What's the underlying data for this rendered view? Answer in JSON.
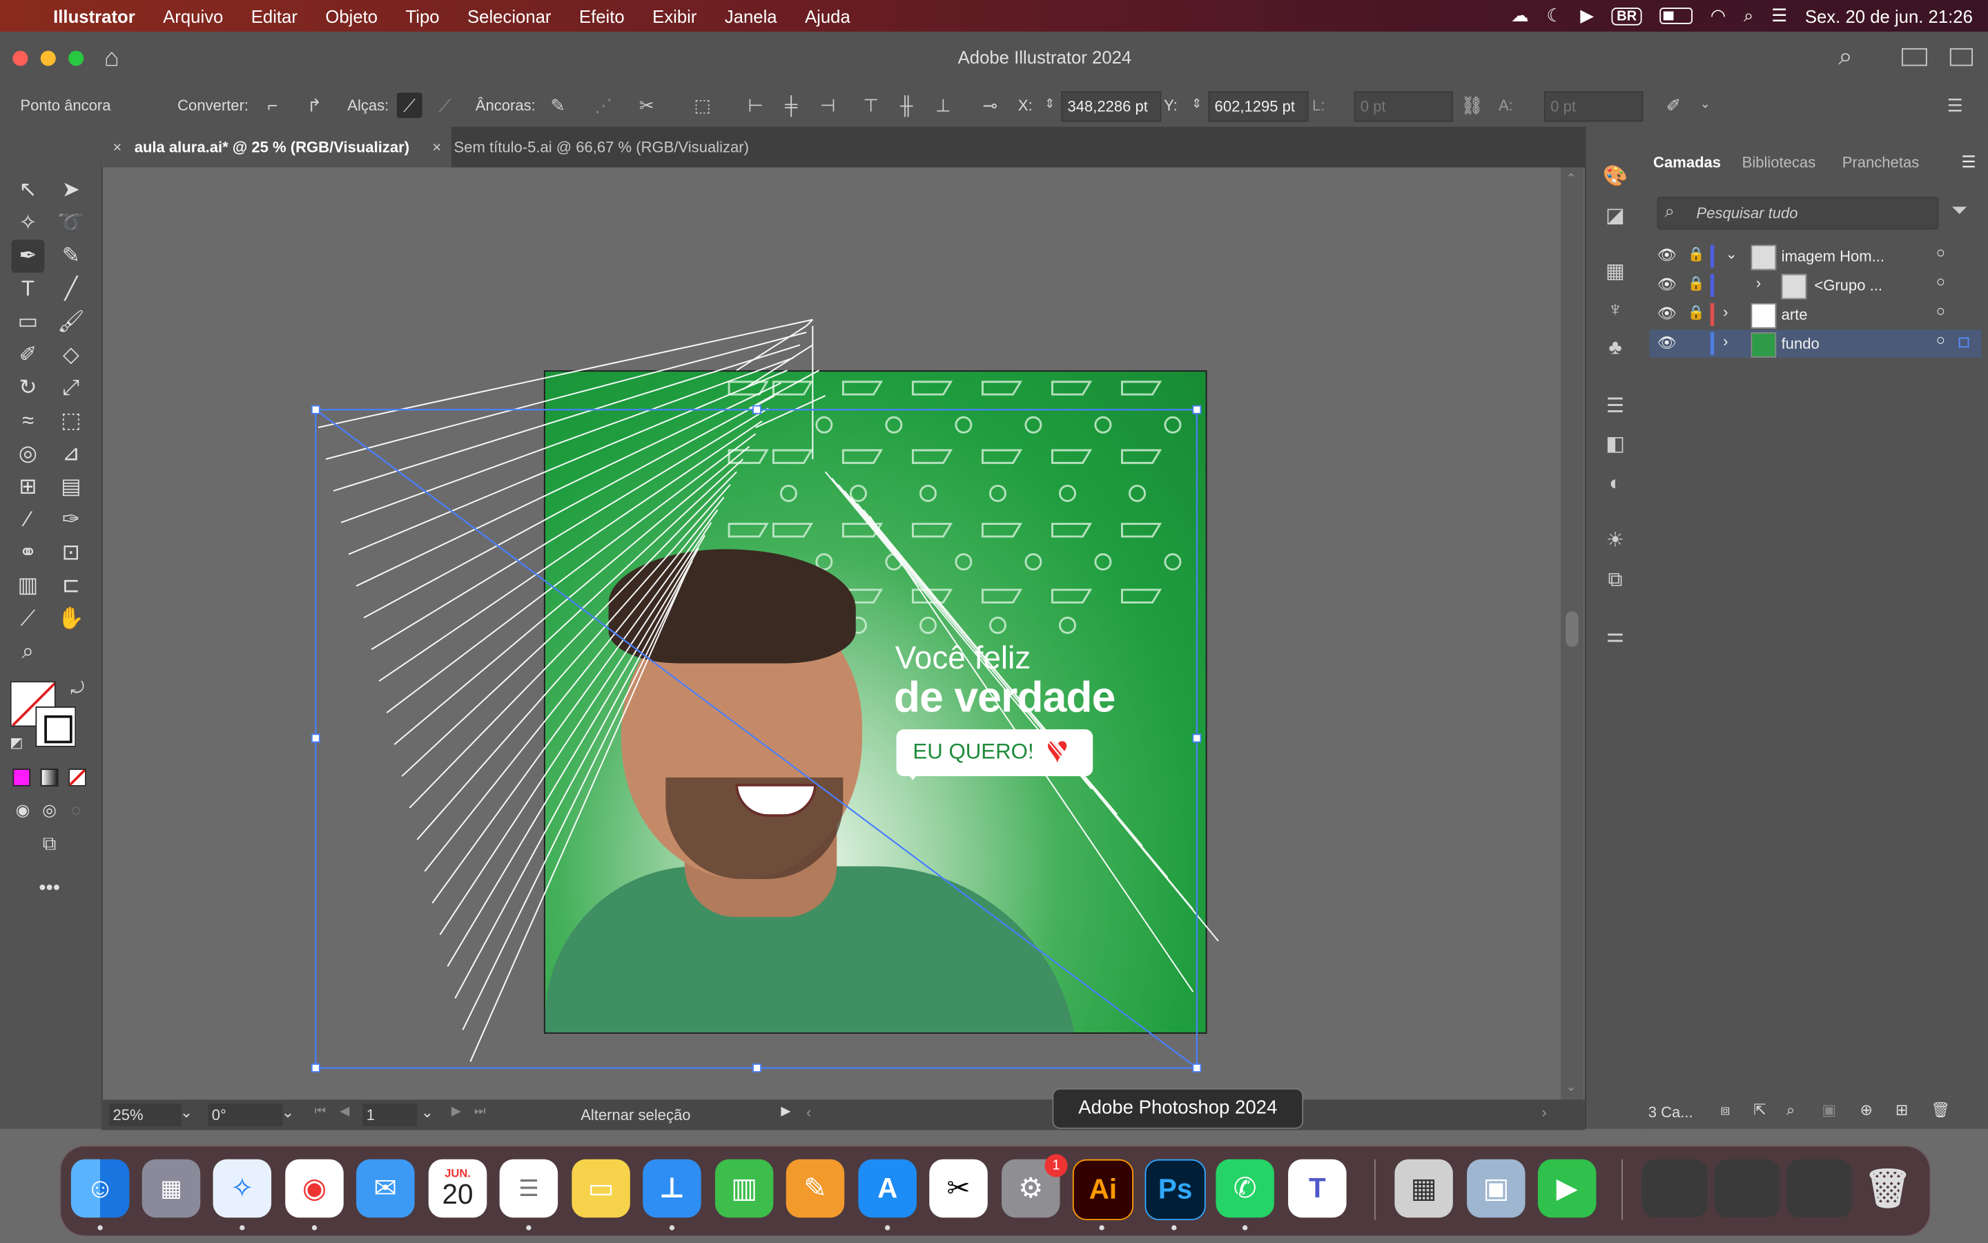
{
  "menubar": {
    "apple": "",
    "app": "Illustrator",
    "items": [
      "Arquivo",
      "Editar",
      "Objeto",
      "Tipo",
      "Selecionar",
      "Efeito",
      "Exibir",
      "Janela",
      "Ajuda"
    ],
    "input_badge": "BR",
    "datetime": "Sex. 20 de jun.  21:26"
  },
  "window": {
    "title": "Adobe Illustrator 2024"
  },
  "controlbar": {
    "mode": "Ponto âncora",
    "convert_label": "Converter:",
    "handles_label": "Alças:",
    "anchors_label": "Âncoras:",
    "x_label": "X:",
    "x_value": "348,2286 pt",
    "y_label": "Y:",
    "y_value": "602,1295 pt",
    "l_label": "L:",
    "l_value": "0 pt",
    "a_label": "A:",
    "a_value": "0 pt"
  },
  "tabs": [
    {
      "label": "aula alura.ai* @ 25 % (RGB/Visualizar)"
    },
    {
      "label": "Sem título-5.ai @ 66,67 % (RGB/Visualizar)"
    }
  ],
  "artwork": {
    "line1": "Você feliz",
    "line2": "de verdade",
    "cta": "EU QUERO!"
  },
  "status": {
    "zoom": "25%",
    "rotation": "0°",
    "artboard": "1",
    "hint": "Alternar seleção"
  },
  "panel": {
    "tabs": [
      "Camadas",
      "Bibliotecas",
      "Pranchetas"
    ],
    "search_placeholder": "Pesquisar tudo",
    "layers": [
      {
        "name": "imagem Hom..."
      },
      {
        "name": "<Grupo ..."
      },
      {
        "name": "arte"
      },
      {
        "name": "fundo"
      }
    ],
    "footer_count": "3 Ca..."
  },
  "dock": {
    "calendar_month": "JUN.",
    "calendar_day": "20",
    "settings_badge": "1",
    "ai_label": "Ai",
    "ps_label": "Ps"
  },
  "tooltip": "Adobe Photoshop 2024",
  "colors": {
    "artboard_green": "#1f9d3e",
    "selection_blue": "#4a7fff",
    "layer_selected": "#4a5a78"
  }
}
